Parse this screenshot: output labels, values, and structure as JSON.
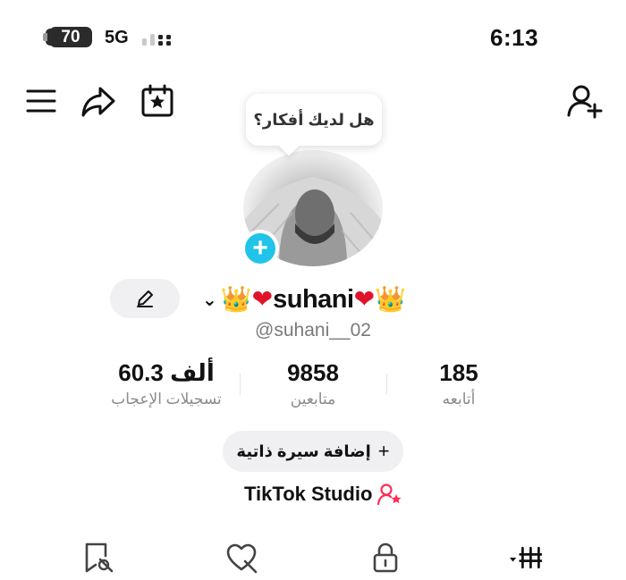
{
  "status_bar": {
    "battery": "70",
    "network": "5G",
    "time": "6:13"
  },
  "top_bar": {
    "icons": [
      "menu-icon",
      "share-icon",
      "calendar-star-icon",
      "add-user-icon"
    ]
  },
  "profile": {
    "bubble_text": "هل لديك أفكار؟",
    "display_name": "suhani",
    "handle": "@suhani__02"
  },
  "stats": [
    {
      "value": "185",
      "label": "أتابعه"
    },
    {
      "value": "9858",
      "label": "متابعين"
    },
    {
      "value": "60.3 ألف",
      "label": "تسجيلات الإعجاب"
    }
  ],
  "bio_button": {
    "label": "إضافة سيرة ذاتية",
    "icon": "+"
  },
  "studio_link": {
    "label": "TikTok Studio"
  },
  "colors": {
    "accent_cyan": "#20c4e8",
    "heart": "#e0132b",
    "crown": "#d9a400",
    "pink": "#fe2c55"
  },
  "bottom_tabs": [
    "grid-icon",
    "lock-icon",
    "liked-icon",
    "favorites-icon"
  ]
}
